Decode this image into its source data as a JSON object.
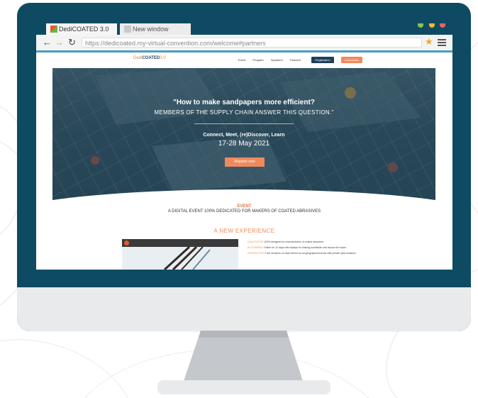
{
  "colors": {
    "monitor_bezel": "#0f4a63",
    "monitor_chin": "#e9eaec",
    "accent_orange": "#f08a5d",
    "accent_blue_line": "#4a9cc7",
    "nav_dark": "#1d3f5a"
  },
  "browser": {
    "tabs": [
      {
        "label": "DediCOATED 3.0",
        "icon": "dedicoated-favicon",
        "active": true
      },
      {
        "label": "New window",
        "icon": "blank-tab-icon",
        "active": false
      }
    ],
    "window_controls": [
      {
        "name": "green-dot",
        "color": "#8bc34a"
      },
      {
        "name": "yellow-dot",
        "color": "#f5b731"
      },
      {
        "name": "red-dot",
        "color": "#f0625a"
      }
    ],
    "address_bar": {
      "url": "https://dedicoated.my-virtual-convention.com/welcome#partners",
      "back_icon": "arrow-left-icon",
      "forward_icon": "arrow-right-icon",
      "reload_icon": "reload-icon",
      "bookmark_icon": "star-icon",
      "menu_icon": "hamburger-icon"
    }
  },
  "site": {
    "logo": {
      "prefix": "Dedi",
      "brand": "COATED",
      "suffix": "3.0"
    },
    "nav": {
      "links": [
        "Event",
        "Program",
        "Speakers",
        "Partners"
      ],
      "registration_label": "Registration",
      "connect_label": "Connection"
    },
    "hero": {
      "title": "\"How to make sandpapers more efficient?",
      "subtitle": "MEMBERS OF THE SUPPLY CHAIN ANSWER THIS QUESTION.\"",
      "tagline": "Connect, Meet, (re)Discover, Learn",
      "dates": "17-28 May 2021",
      "cta_label": "Register now"
    },
    "event": {
      "label": "EVENT",
      "description": "A DIGITAL EVENT 100% DEDICATED FOR MAKERS OF COATED ABRASIVES"
    },
    "experience": {
      "title": "A NEW EXPERIENCE",
      "features": [
        {
          "key": "QUALITATIVE",
          "text": "100% designed for manufacturers of coated abrasives"
        },
        {
          "key": "ACCESSIBLE",
          "text": "Online for 12 days with replays for sharing worldwide and across the board"
        },
        {
          "key": "INTERACTIVE",
          "text": "2 live sessions on each theme for all geographical areas with private Q&A sessions"
        }
      ]
    }
  }
}
